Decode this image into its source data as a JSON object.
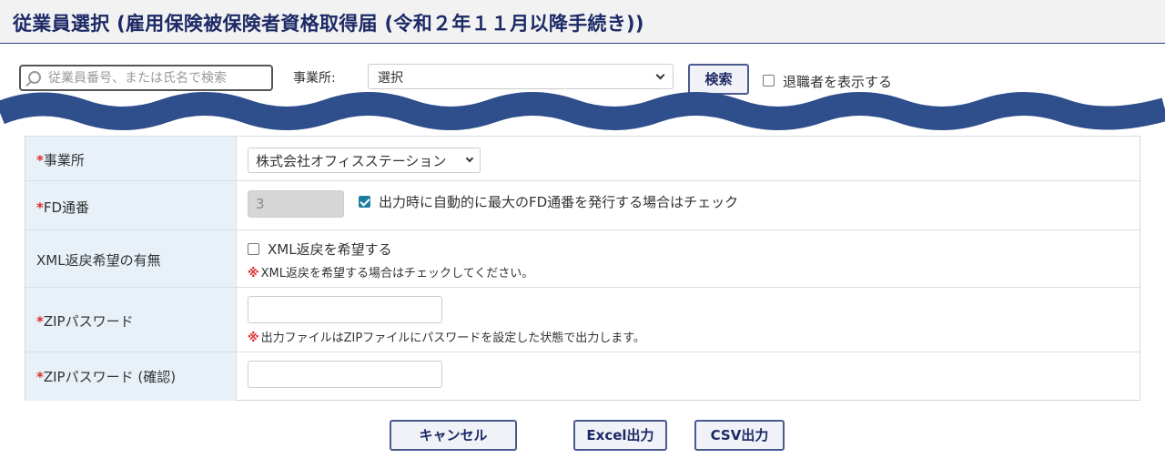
{
  "header": {
    "title": "従業員選択 (雇用保険被保険者資格取得届 (令和２年１１月以降手続き))"
  },
  "filters": {
    "search_placeholder": "従業員番号、または氏名で検索",
    "office_label": "事業所:",
    "office_selected": "選択",
    "search_button": "検索",
    "show_retired_label": "退職者を表示する",
    "show_retired_checked": false
  },
  "form": {
    "office": {
      "label": "事業所",
      "required": true,
      "selected": "株式会社オフィスステーション"
    },
    "fd_number": {
      "label": "FD通番",
      "required": true,
      "value": "3",
      "auto_checked": true,
      "auto_label": "出力時に自動的に最大のFD通番を発行する場合はチェック"
    },
    "xml_return": {
      "label": "XML返戻希望の有無",
      "required": false,
      "checked": false,
      "option_label": "XML返戻を希望する",
      "note": "XML返戻を希望する場合はチェックしてください。"
    },
    "zip_password": {
      "label": "ZIPパスワード",
      "required": true,
      "value": "",
      "note": "出力ファイルはZIPファイルにパスワードを設定した状態で出力します。"
    },
    "zip_password_confirm": {
      "label": "ZIPパスワード (確認)",
      "required": true,
      "value": ""
    },
    "required_mark": "*",
    "note_mark": "※"
  },
  "actions": {
    "cancel": "キャンセル",
    "excel": "Excel出力",
    "csv": "CSV出力"
  },
  "colors": {
    "title": "#1d2a66",
    "wave": "#2f4e8c",
    "required": "#d9302c",
    "label_bg": "#e8f1f8",
    "checkbox_checked": "#1a7ea0"
  }
}
